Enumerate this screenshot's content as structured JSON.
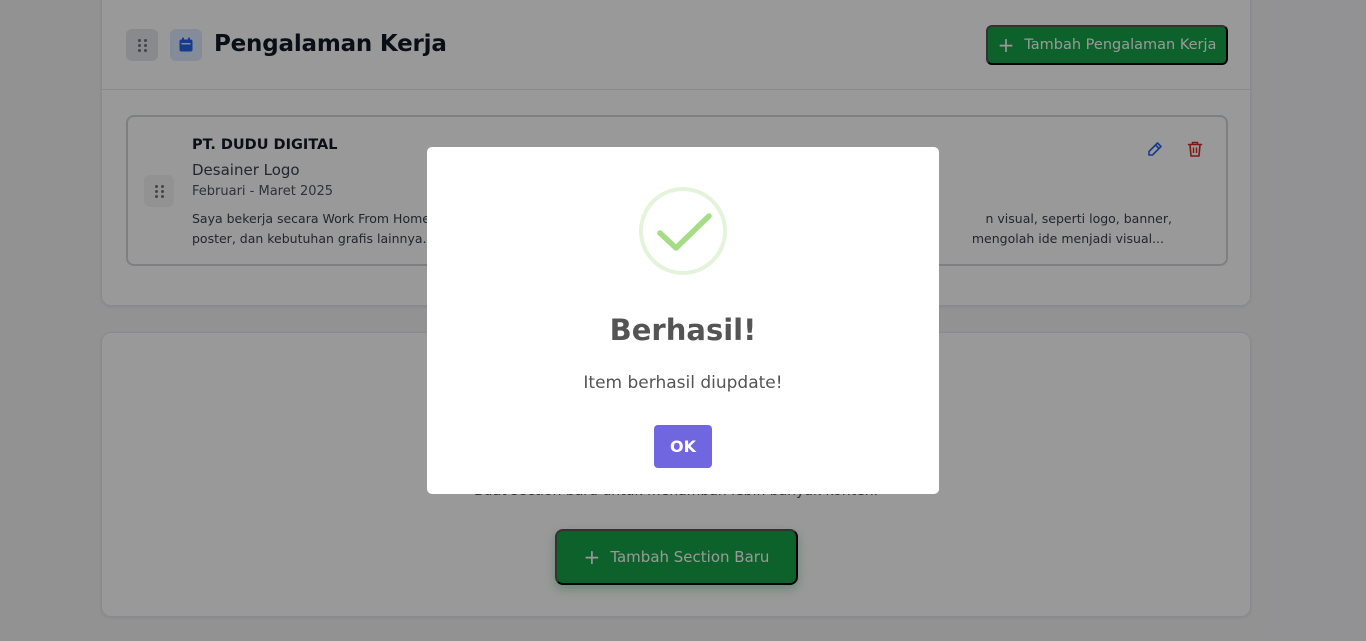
{
  "section": {
    "title": "Pengalaman Kerja",
    "add_button_label": "Tambah Pengalaman Kerja",
    "icon": "calendar-icon"
  },
  "experience": {
    "company": "PT. DUDU DIGITAL",
    "position": "Desainer Logo",
    "period": "Februari - Maret 2025",
    "description_line1_start": "Saya bekerja secara Work From Home",
    "description_line1_end": "n visual, seperti logo, banner,",
    "description_line2_start": "poster, dan kebutuhan grafis lainnya. D",
    "description_line2_end": "mengolah ide menjadi visual..."
  },
  "new_section": {
    "description": "Buat section baru untuk menambah lebih banyak konten.",
    "button_label": "Tambah Section Baru"
  },
  "modal": {
    "title": "Berhasil!",
    "message": "Item berhasil diupdate!",
    "ok_label": "OK"
  },
  "colors": {
    "accent_green": "#16a34a",
    "ok_purple": "#7066e0",
    "success_check": "#a5dc86",
    "edit_blue": "#2563eb",
    "delete_red": "#dc2626"
  }
}
